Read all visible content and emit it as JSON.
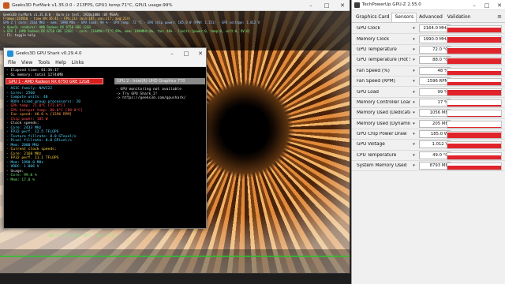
{
  "furmark": {
    "title": "Geeks3D FurMark v1.35.0.0 - 213FPS, GPU1 temp:71°C, GPU1 usage:99%",
    "osd": [
      "Geeks3D FurMark v1.35.0.0 - Burn-in test, 1920x1080 (0X MSAA)",
      "Frames:124918 - time:09:36:41 - FPS:213 (min:187, max:217, avg:214)",
      "GPU-Z | core: 2164 MHz - mem: 1990 MHz - GPU load: 99 % - GPU temp: 72 °C - GPU chip power: 185.0 W (PPW: 1.151) - GPU voltage: 1.012 V",
      "> OpenGL renderer: AMD Radeon RX 6750 GRE 12GB",
      "> GPU 1 (AMD Radeon RX 6750 GRE 12GB) - core: 2164MHz:71°C:99%, mem: 1990MHz:0%, fan: 48% - limits:[power:0, temp:0, volt:0, OV:0]",
      "- F1: toggle help"
    ],
    "osd_bottom": "GPU 1: 71°C (min: 43°C - max: 72°C)"
  },
  "shark": {
    "title": "Geeks3D GPU Shark v0.29.4.0",
    "menu": [
      "File",
      "View",
      "Tools",
      "Help",
      "Links"
    ],
    "tab1": "GPU 1 - AMD Radeon RX 6750 GRE 12GB",
    "tab2": "GPU 2 - Intel(R) UHD Graphics 770",
    "header_lines": [
      "- Elapsed time: 01:36:17",
      "- GL memory: total 12744MB"
    ],
    "lines": [
      {
        "t": "- ASIC family: NAVI22",
        "c": "c-c"
      },
      {
        "t": "- Cores: 2560",
        "c": "c-c"
      },
      {
        "t": "- Compute units: 40",
        "c": "c-c"
      },
      {
        "t": "- ROPs (simd group processors): 20",
        "c": "c-c"
      },
      {
        "t": "- GPU temp: 71.0°C [72.0°C]",
        "c": "c-r"
      },
      {
        "t": "- GPU hotspot temp: 80.0°C [88.0°C]",
        "c": "c-r"
      },
      {
        "t": "- Fan speed: 48.0 % [1596 RPM]",
        "c": "c-o"
      },
      {
        "t": "- Chip power: 185 W",
        "c": "c-r"
      },
      {
        "t": "- Clock speeds:",
        "c": "c-w"
      },
      {
        "t": "  - Core: 2433 MHz",
        "c": "c-c"
      },
      {
        "t": "  - FP32 perf. 12.5 TFLOPS",
        "c": "c-c"
      },
      {
        "t": "  - Texture fillrate: 8.0 GTexel/s",
        "c": "c-c"
      },
      {
        "t": "  - Pixel fillrate: 8.0 GPixel/s",
        "c": "c-c"
      },
      {
        "t": "  - Mem: 2000 MHz",
        "c": "c-c"
      },
      {
        "t": "- Current clock speeds:",
        "c": "c-y"
      },
      {
        "t": "  - Core: 2168 MHz",
        "c": "c-y"
      },
      {
        "t": "  - FP32 perf. 11.1 TFLOPS",
        "c": "c-y"
      },
      {
        "t": "  - Mem: 1990.0 MHz",
        "c": "c-c"
      },
      {
        "t": "  - VDDC: 1.006 V",
        "c": "c-c"
      },
      {
        "t": "- Usage:",
        "c": "c-w"
      },
      {
        "t": "  - Core: 99.0 %",
        "c": "c-g"
      },
      {
        "t": "  - Mem: 17.0 %",
        "c": "c-g"
      }
    ],
    "lines2": [
      "- GPU monitoring not available",
      "  -> Try GPU Shark 2!",
      "  -> https://geeks3d.com/gpushark/"
    ]
  },
  "gpuz": {
    "title": "TechPowerUp GPU-Z 2.55.0",
    "tabs": [
      "Graphics Card",
      "Sensors",
      "Advanced",
      "Validation"
    ],
    "active_tab": "Sensors",
    "sensors": [
      {
        "name": "GPU Clock",
        "value": "2164.0 MHz",
        "level": 0.8
      },
      {
        "name": "Memory Clock",
        "value": "1990.0 MHz",
        "level": 0.95
      },
      {
        "name": "GPU Temperature",
        "value": "72.0 °C",
        "level": 0.9
      },
      {
        "name": "GPU Temperature (Hot Spot)",
        "value": "88.0 °C",
        "level": 0.92
      },
      {
        "name": "Fan Speed (%)",
        "value": "48 %",
        "level": 0.55
      },
      {
        "name": "Fan Speed (RPM)",
        "value": "1596 RPM",
        "level": 0.55
      },
      {
        "name": "GPU Load",
        "value": "99 %",
        "level": 0.98
      },
      {
        "name": "Memory Controller Load",
        "value": "17 %",
        "level": 0.2
      },
      {
        "name": "Memory Used (Dedicated)",
        "value": "1056 MB",
        "level": 0.15
      },
      {
        "name": "Memory Used (Dynamic)",
        "value": "205 MB",
        "level": 0.1
      },
      {
        "name": "GPU Chip Power Draw",
        "value": "185.0 W",
        "level": 0.9
      },
      {
        "name": "GPU Voltage",
        "value": "1.012 V",
        "level": 0.85
      },
      {
        "name": "CPU Temperature",
        "value": "49.0 °C",
        "level": 0.55
      },
      {
        "name": "System Memory Used",
        "value": "8793 MB",
        "level": 0.6
      }
    ]
  }
}
